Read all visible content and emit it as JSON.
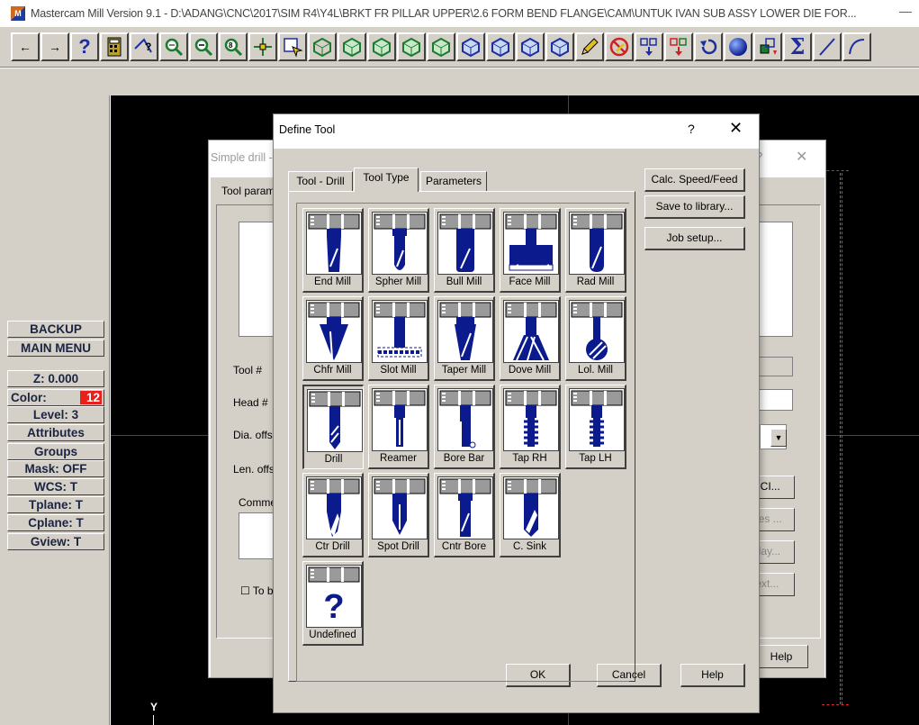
{
  "window": {
    "title": "Mastercam Mill Version 9.1 - D:\\ADANG\\CNC\\2017\\SIM R4\\Y4L\\BRKT FR PILLAR UPPER\\2.6 FORM BEND FLANGE\\CAM\\UNTUK IVAN SUB ASSY LOWER DIE FOR...",
    "minimize": "—"
  },
  "toolbar": {
    "back": "←",
    "forward": "→",
    "help": "?"
  },
  "side_menu": {
    "backup": "BACKUP",
    "main_menu": "MAIN MENU",
    "z": "Z:  0.000",
    "color_label": "Color:",
    "color_value": "12",
    "level": "Level:  3",
    "attributes": "Attributes",
    "groups": "Groups",
    "mask": "Mask:  OFF",
    "wcs": "WCS:  T",
    "tplane": "Tplane:  T",
    "cplane": "Cplane:  T",
    "gview": "Gview:  T"
  },
  "graphics": {
    "y_axis": "Y"
  },
  "simple_drill_dialog": {
    "title": "Simple drill -",
    "help": "?",
    "close": "✕",
    "tab_label": "Tool parame",
    "tool_num": "Tool #",
    "head_num": "Head #",
    "dia_offset": "Dia. offs",
    "len_offset": "Len. offs",
    "comment": "Commer",
    "checkbox_label": "To b",
    "nci_button": "NCI...",
    "values_button": "ues ...",
    "display_button": "play...",
    "text_button": "text...",
    "help_button": "Help"
  },
  "define_tool": {
    "title": "Define Tool",
    "help": "?",
    "close": "✕",
    "tabs": [
      "Tool - Drill",
      "Tool Type",
      "Parameters"
    ],
    "tools": [
      "End Mill",
      "Spher Mill",
      "Bull Mill",
      "Face Mill",
      "Rad Mill",
      "Chfr Mill",
      "Slot Mill",
      "Taper Mill",
      "Dove Mill",
      "Lol. Mill",
      "Drill",
      "Reamer",
      "Bore Bar",
      "Tap RH",
      "Tap LH",
      "Ctr Drill",
      "Spot Drill",
      "Cntr Bore",
      "C. Sink",
      "Undefined"
    ],
    "selected_tool": "Drill",
    "right_buttons": {
      "calc": "Calc. Speed/Feed",
      "save": "Save to library...",
      "job": "Job setup..."
    },
    "ok": "OK",
    "cancel": "Cancel",
    "help_button": "Help"
  },
  "colors": {
    "dialog_face": "#d4d0c8",
    "tool_blue": "#0b1a8c",
    "canvas": "#000000",
    "axis_red": "#c21010",
    "boundary_green": "#1fae2a",
    "color_swatch": "#e8201c"
  }
}
